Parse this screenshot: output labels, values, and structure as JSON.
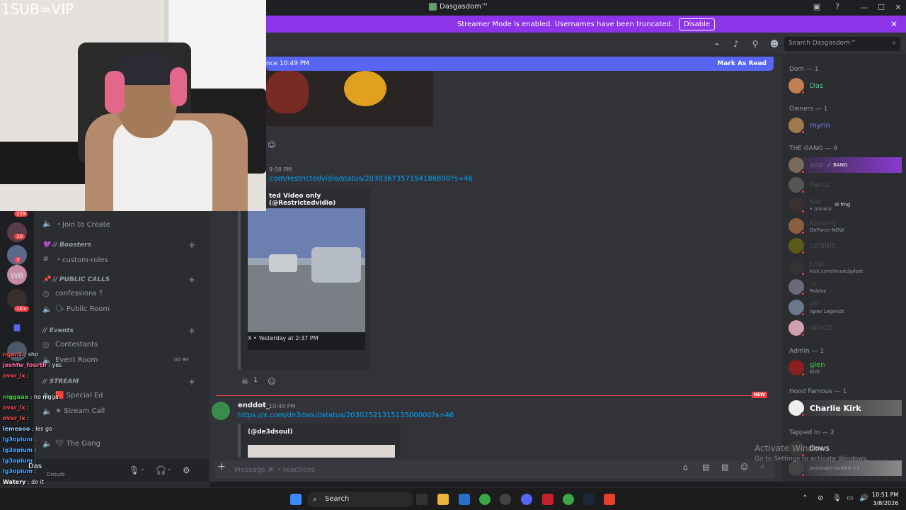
{
  "window": {
    "title": "Dasgasdom™",
    "min": "—",
    "max": "☐",
    "close": "✕"
  },
  "banner": {
    "text": "Streamer Mode is enabled. Usernames have been truncated.",
    "button": "Disable",
    "close": "✕"
  },
  "header": {
    "search_placeholder": "Search Dasgasdom™"
  },
  "new_messages": {
    "since": "nce 10:49 PM",
    "mark_read": "Mark As Read"
  },
  "messages": [
    {
      "time": "9:08 PM",
      "link": ".com/restrictedvidio/status/2030367357194186890?s=46",
      "embed_title": "ted Video only (@Restrictedvidio)",
      "embed_footer": "X • Yesterday at 2:37 PM",
      "reaction_count": "1"
    },
    {
      "author": "enddot_",
      "time": "10:49 PM",
      "link": "https://x.com/de3dsoul/status/2030252131513500000?s=46",
      "embed_title": "(@de3dsoul)"
    }
  ],
  "new_tag": "NEW",
  "composer": {
    "placeholder": "Message # ・reactions"
  },
  "channels": [
    {
      "label": "・Join to Create",
      "icon": "speaker-icon"
    },
    {
      "label": "💜 // Boosters",
      "type": "category"
    },
    {
      "label": "・custom-roles",
      "icon": "hash-icon"
    },
    {
      "label": "📌 // PUBLIC CALLS",
      "type": "category"
    },
    {
      "label": "confessions ?",
      "icon": "stage-icon"
    },
    {
      "label": "🗣 Public Room",
      "icon": "speaker-icon"
    },
    {
      "label": "// Events",
      "type": "category"
    },
    {
      "label": "Contestants",
      "icon": "stage-icon"
    },
    {
      "label": "Event Room",
      "icon": "speaker-icon",
      "counts": "00  99"
    },
    {
      "label": "// STREAM",
      "type": "category"
    },
    {
      "label": "🟥 Special Ed",
      "icon": "speaker-icon"
    },
    {
      "label": "☀ Stream Call",
      "icon": "speaker-icon"
    },
    {
      "label": "🖤 The Gang",
      "icon": "speaker-icon"
    }
  ],
  "server_badges": [
    "229",
    "30",
    "3",
    "WB",
    "1K+"
  ],
  "userbar": {
    "name": "Das",
    "status": "Disturb"
  },
  "members": {
    "sections": [
      {
        "header": "Dom — 1",
        "items": [
          {
            "name": "Das",
            "sub": ""
          }
        ]
      },
      {
        "header": "Owners — 1",
        "items": [
          {
            "name": "myrin",
            "sub": ""
          }
        ]
      },
      {
        "header": "THE GANG — 9",
        "items": [
          {
            "name": "ada",
            "sub": "",
            "tag": "☄ BANG"
          },
          {
            "name": "Fanos",
            "sub": ""
          },
          {
            "name": "Kar",
            "sub": "• /smack",
            "tag": "✉ fmg"
          },
          {
            "name": "Kenicky",
            "sub": "GeForce NOW"
          },
          {
            "name": "LONNIE",
            "sub": ""
          },
          {
            "name": "Lost",
            "sub": "kick.com/musicbylost"
          },
          {
            "name": "m",
            "sub": "Roblox"
          },
          {
            "name": "PP",
            "sub": "Apex Legends"
          },
          {
            "name": "WOOS",
            "sub": ""
          }
        ]
      },
      {
        "header": "Admin — 1",
        "items": [
          {
            "name": "glen",
            "sub": "Kick"
          }
        ]
      },
      {
        "header": "Hood Famous — 1",
        "items": [
          {
            "name": "Charlie Kirk",
            "sub": ""
          }
        ]
      },
      {
        "header": "Tapped In — 2",
        "items": [
          {
            "name": "Dows",
            "sub": ""
          },
          {
            "name": "",
            "sub": "jerkmate-ranked +1"
          }
        ]
      }
    ]
  },
  "cam_label": "1SUB=VIP",
  "chat_overlay": [
    {
      "user": "ngan1",
      "text": "sho"
    },
    {
      "user": "joshfw_fourth",
      "text": "yes"
    },
    {
      "user": "ovxr_ix",
      "text": ""
    },
    {
      "user": "niggaaa",
      "text": "no nigga"
    },
    {
      "user": "ovxr_ix",
      "text": ""
    },
    {
      "user": "ovxr_ix",
      "text": ""
    },
    {
      "user": "lemeaoo",
      "text": "les go"
    },
    {
      "user": "lg3opium",
      "text": ""
    },
    {
      "user": "lg3opium",
      "text": ""
    },
    {
      "user": "lg3opium",
      "text": ""
    },
    {
      "user": "lg3opium",
      "text": ""
    },
    {
      "user": "Watery",
      "text": "do it"
    }
  ],
  "activate": {
    "title": "Activate Windows",
    "sub": "Go to Settings to activate Windows."
  },
  "taskbar": {
    "search": "Search",
    "time": "10:51 PM",
    "date": "3/8/2026"
  }
}
